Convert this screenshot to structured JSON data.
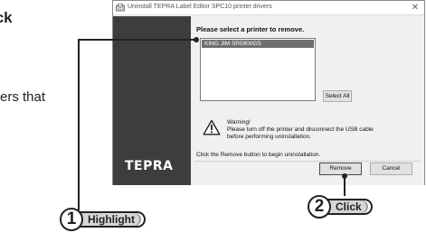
{
  "background": {
    "top_text": "ick",
    "mid_text": "ers that"
  },
  "window": {
    "title": "Uninstall TEPRA Label Editor SPC10 printer drivers",
    "close_glyph": "✕",
    "logo": "TEPRA",
    "heading": "Please select a printer to remove.",
    "printers": [
      "KING JIM SR5900GS"
    ],
    "select_all_label": "Select All",
    "warning_title": "Warning!",
    "warning_line1": "Please turn off the printer and disconnect the USB cable",
    "warning_line2": "before performing uninstallation.",
    "instruction": "Click the Remove button to begin uninstallation.",
    "remove_label": "Remove",
    "cancel_label": "Cancel"
  },
  "callouts": [
    {
      "number": "1",
      "label": "Highlight"
    },
    {
      "number": "2",
      "label": "Click"
    }
  ],
  "colors": {
    "side_panel": "#3d3d3d",
    "selection": "#6e6e6e",
    "callout_pill": "#d6d6d6"
  }
}
